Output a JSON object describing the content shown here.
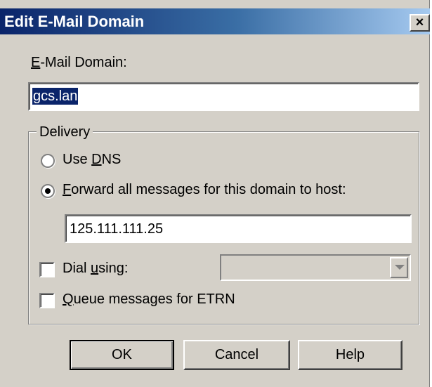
{
  "window": {
    "title": "Edit E-Mail Domain",
    "close_glyph": "×"
  },
  "domain": {
    "label_first": "E",
    "label_rest": "-Mail Domain:",
    "value": "gcs.lan"
  },
  "delivery": {
    "group_label": "Delivery",
    "use_dns_pre": "Use ",
    "use_dns_mnemonic": "D",
    "use_dns_post": "NS",
    "use_dns_selected": false,
    "forward_mnemonic": "F",
    "forward_rest": "orward all messages for this domain to host:",
    "forward_selected": true,
    "host_value": "125.111.111.25",
    "dial_pre": "Dial ",
    "dial_mnemonic": "u",
    "dial_post": "sing:",
    "dial_checked": false,
    "dial_value": "",
    "queue_mnemonic": "Q",
    "queue_rest": "ueue messages for ETRN",
    "queue_checked": false
  },
  "buttons": {
    "ok": "OK",
    "cancel": "Cancel",
    "help": "Help"
  },
  "colors": {
    "title_bar": "#0a246a",
    "face": "#d4d0c8",
    "selection": "#0a246a"
  }
}
